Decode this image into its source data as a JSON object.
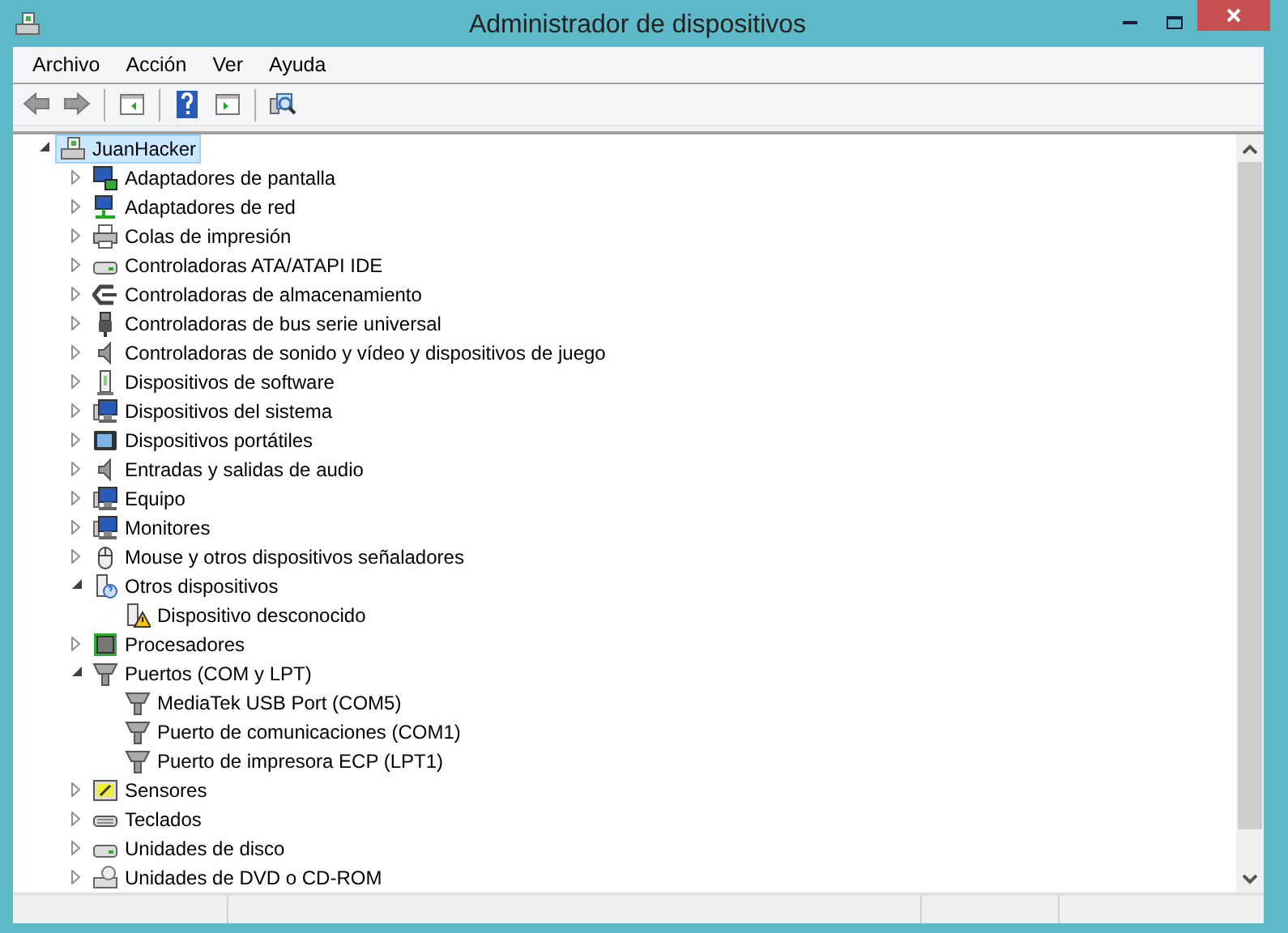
{
  "window": {
    "title": "Administrador de dispositivos"
  },
  "menu": [
    "Archivo",
    "Acción",
    "Ver",
    "Ayuda"
  ],
  "toolbar": [
    {
      "kind": "back"
    },
    {
      "kind": "forward"
    },
    {
      "kind": "separator"
    },
    {
      "kind": "tree"
    },
    {
      "kind": "separator"
    },
    {
      "kind": "help"
    },
    {
      "kind": "panel"
    },
    {
      "kind": "separator"
    },
    {
      "kind": "scan"
    }
  ],
  "tree": [
    {
      "label": "JuanHacker",
      "kind": "computer",
      "selected": true,
      "expanded": true,
      "children": [
        {
          "label": "Adaptadores de pantalla",
          "kind": "display",
          "selected": false,
          "expanded": false
        },
        {
          "label": "Adaptadores de red",
          "kind": "network",
          "selected": false,
          "expanded": false
        },
        {
          "label": "Colas de impresión",
          "kind": "printer",
          "selected": false,
          "expanded": false
        },
        {
          "label": "Controladoras ATA/ATAPI IDE",
          "kind": "drive",
          "selected": false,
          "expanded": false
        },
        {
          "label": "Controladoras de almacenamiento",
          "kind": "storage",
          "selected": false,
          "expanded": false
        },
        {
          "label": "Controladoras de bus serie universal",
          "kind": "usb",
          "selected": false,
          "expanded": false
        },
        {
          "label": "Controladoras de sonido y vídeo y dispositivos de juego",
          "kind": "speaker",
          "selected": false,
          "expanded": false
        },
        {
          "label": "Dispositivos de software",
          "kind": "software",
          "selected": false,
          "expanded": false
        },
        {
          "label": "Dispositivos del sistema",
          "kind": "monitor",
          "selected": false,
          "expanded": false
        },
        {
          "label": "Dispositivos portátiles",
          "kind": "portable",
          "selected": false,
          "expanded": false
        },
        {
          "label": "Entradas y salidas de audio",
          "kind": "speaker",
          "selected": false,
          "expanded": false
        },
        {
          "label": "Equipo",
          "kind": "monitor",
          "selected": false,
          "expanded": false
        },
        {
          "label": "Monitores",
          "kind": "monitor",
          "selected": false,
          "expanded": false
        },
        {
          "label": "Mouse y otros dispositivos señaladores",
          "kind": "mouse",
          "selected": false,
          "expanded": false
        },
        {
          "label": "Otros dispositivos",
          "kind": "unknown",
          "selected": false,
          "expanded": true,
          "children": [
            {
              "label": "Dispositivo desconocido",
              "kind": "warning",
              "selected": false
            }
          ]
        },
        {
          "label": "Procesadores",
          "kind": "chip",
          "selected": false,
          "expanded": false
        },
        {
          "label": "Puertos (COM y LPT)",
          "kind": "port",
          "selected": false,
          "expanded": true,
          "children": [
            {
              "label": "MediaTek USB Port (COM5)",
              "kind": "port",
              "selected": false
            },
            {
              "label": "Puerto de comunicaciones (COM1)",
              "kind": "port",
              "selected": false
            },
            {
              "label": "Puerto de impresora ECP (LPT1)",
              "kind": "port",
              "selected": false
            }
          ]
        },
        {
          "label": "Sensores",
          "kind": "sensor",
          "selected": false,
          "expanded": false
        },
        {
          "label": "Teclados",
          "kind": "keyboard",
          "selected": false,
          "expanded": false
        },
        {
          "label": "Unidades de disco",
          "kind": "drive",
          "selected": false,
          "expanded": false
        },
        {
          "label": "Unidades de DVD o CD-ROM",
          "kind": "disc",
          "selected": false,
          "expanded": false
        }
      ]
    }
  ]
}
